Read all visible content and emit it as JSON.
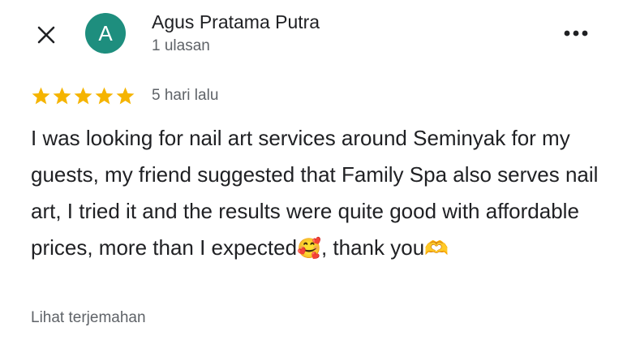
{
  "header": {
    "close_icon": "close-icon",
    "more_icon": "more-options-icon"
  },
  "reviewer": {
    "avatar_letter": "A",
    "avatar_color": "#1e8e7e",
    "name": "Agus Pratama Putra",
    "review_count": "1 ulasan"
  },
  "review": {
    "rating": 5,
    "max_rating": 5,
    "star_color": "#f5b400",
    "date": "5 hari lalu",
    "text_part1": "I was looking for nail art services around Seminyak for my guests, my friend suggested that Family Spa also serves nail art, I tried it and the results were quite good with affordable prices, more than I expected",
    "emoji1": "🥰",
    "text_part2": ", thank you",
    "emoji2": "🫶"
  },
  "footer": {
    "translate_label": "Lihat terjemahan"
  }
}
